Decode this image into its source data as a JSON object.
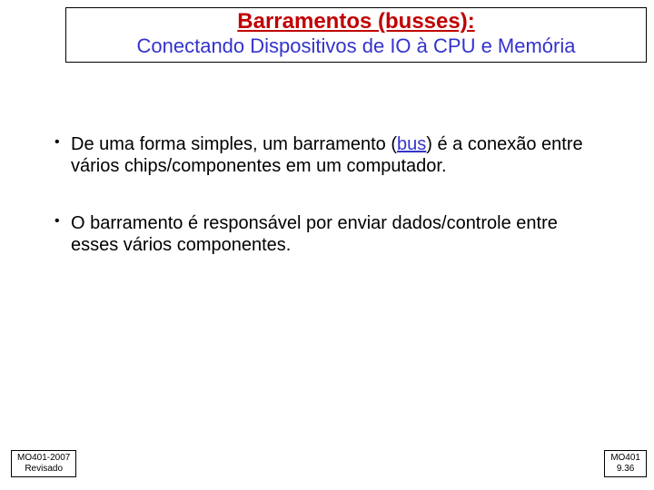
{
  "header": {
    "title": "Barramentos (busses):",
    "subtitle": "Conectando Dispositivos de IO à CPU e Memória"
  },
  "bullets": [
    {
      "pre": "De uma forma simples, um  barramento (",
      "term": "bus",
      "post": ") é a conexão entre vários chips/componentes em  um computador."
    },
    {
      "pre": "O barramento é responsável por enviar dados/controle entre esses vários componentes.",
      "term": "",
      "post": ""
    }
  ],
  "footer": {
    "left_line1": "MO401-2007",
    "left_line2": "Revisado",
    "right_line1": "MO401",
    "right_line2": "9.36"
  }
}
